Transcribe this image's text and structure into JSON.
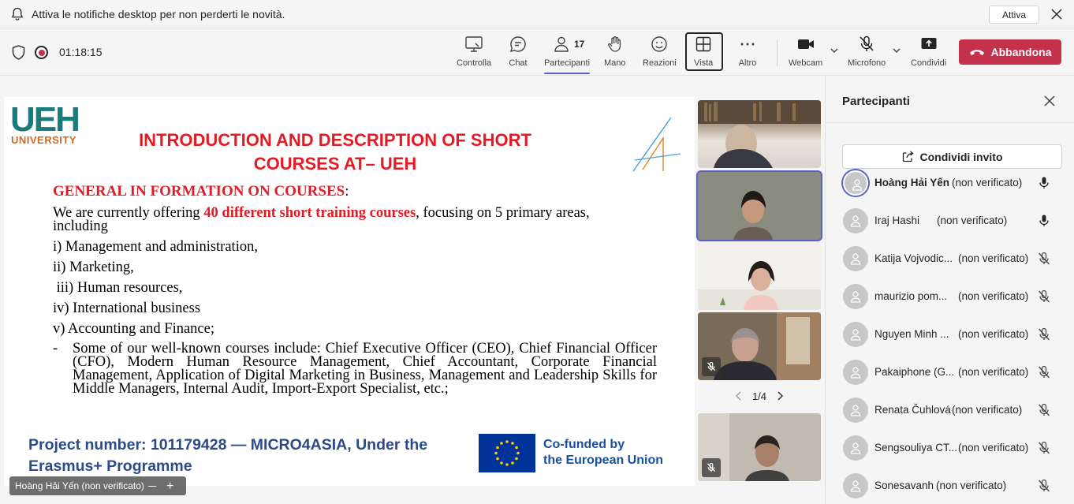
{
  "notification": {
    "text": "Attiva le notifiche desktop per non perderti le novità.",
    "activate_label": "Attiva"
  },
  "toolbar": {
    "timer": "01:18:15",
    "buttons": {
      "controlla": "Controlla",
      "chat": "Chat",
      "partecipanti": "Partecipanti",
      "partecipanti_count": "17",
      "mano": "Mano",
      "reazioni": "Reazioni",
      "vista": "Vista",
      "altro": "Altro",
      "webcam": "Webcam",
      "microfono": "Microfono",
      "condividi": "Condividi"
    },
    "leave_label": "Abbandona",
    "colors": {
      "leave": "#c4314b",
      "accent": "#5b5fc7"
    }
  },
  "slide": {
    "logo_main": "UEH",
    "logo_sub": "UNIVERSITY",
    "title_line1": "INTRODUCTION AND DESCRIPTION OF SHORT",
    "title_line2": "COURSES AT– UEH",
    "section_title": "GENERAL IN FORMATION ON COURSES",
    "section_colon": ":",
    "intro_prefix": "We are currently offering ",
    "intro_highlight": "40 different short  training courses",
    "intro_suffix": ", focusing on 5 primary areas,",
    "intro_line2": "including",
    "areas": [
      "i) Management and administration,",
      "ii) Marketing,",
      " iii) Human resources,",
      "iv) International business",
      "v) Accounting and Finance;"
    ],
    "bullet_dash": "-",
    "bullet_text": "Some of our well-known courses include: Chief Executive Officer (CEO), Chief Financial Officer (CFO), Modern Human Resource Management, Chief Accountant, Corporate Financial Management, Application of Digital Marketing in Business, Management and Leadership Skills for Middle Managers, Internal Audit, Import-Export Specialist, etc.;",
    "project_text": "Project number: 101179428 — MICRO4ASIA, Under the Erasmus+ Programme",
    "eu_line1": "Co-funded by",
    "eu_line2": "the European Union",
    "colors": {
      "title_red": "#e21b24",
      "logo_teal": "#1b7a7a",
      "project_blue": "#2a4a8a"
    }
  },
  "presenter_tag": "Hoàng Hải Yến (non verificato)",
  "pager": {
    "label": "1/4"
  },
  "panel": {
    "title": "Partecipanti",
    "invite_label": "Condividi invito",
    "participants": [
      {
        "name": "Hoàng Hải Yến",
        "status": "(non verificato)",
        "mic": "mic-on"
      },
      {
        "name": "Iraj Hashi",
        "status": "(non verificato)",
        "mic": "mic-on"
      },
      {
        "name": "Katija Vojvodic...",
        "status": "(non verificato)",
        "mic": "mic-off"
      },
      {
        "name": "maurizio pom...",
        "status": "(non verificato)",
        "mic": "mic-off"
      },
      {
        "name": "Nguyen Minh ...",
        "status": "(non verificato)",
        "mic": "mic-off"
      },
      {
        "name": "Pakaiphone (G...",
        "status": "(non verificato)",
        "mic": "mic-off"
      },
      {
        "name": "Renata Čuhlová",
        "status": "(non verificato)",
        "mic": "mic-off"
      },
      {
        "name": "Sengsouliya CT...",
        "status": "(non verificato)",
        "mic": "mic-off"
      },
      {
        "name": "Sonesavanh",
        "status": "(non verificato)",
        "mic": "mic-off"
      }
    ]
  }
}
